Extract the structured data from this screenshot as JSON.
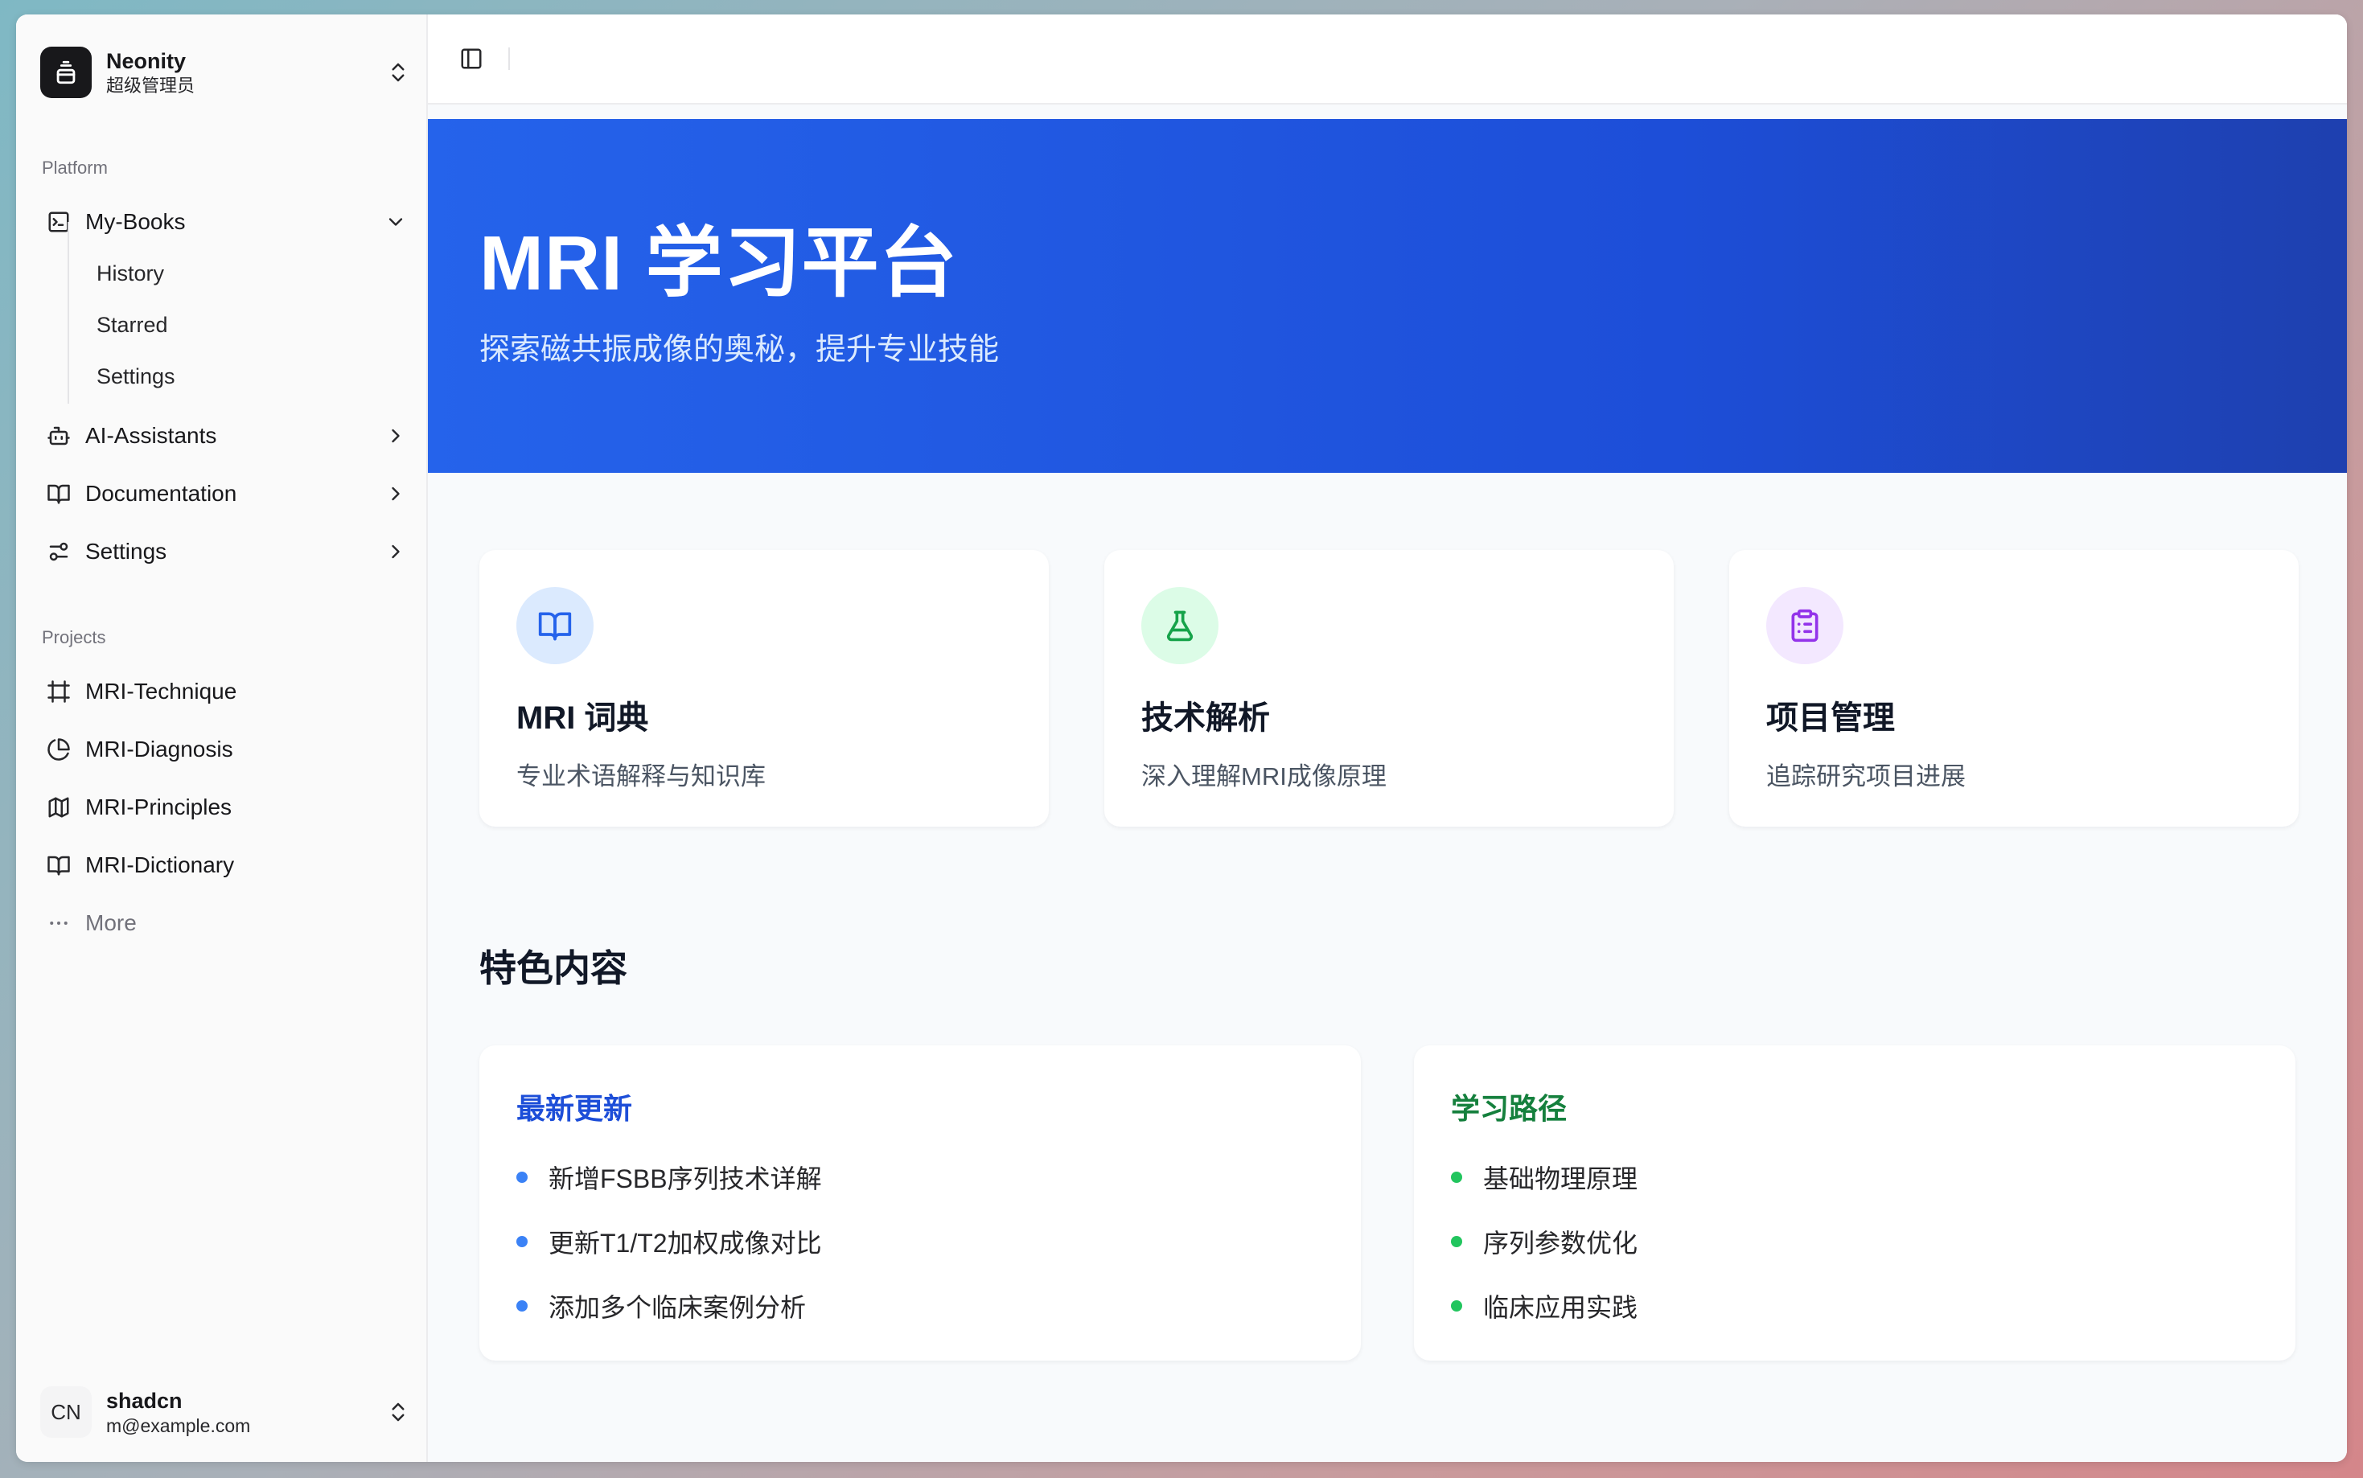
{
  "team": {
    "name": "Neonity",
    "role": "超级管理员"
  },
  "platform": {
    "label": "Platform",
    "items": [
      {
        "label": "My-Books",
        "icon": "terminal-icon",
        "expanded": true,
        "children": [
          {
            "label": "History"
          },
          {
            "label": "Starred"
          },
          {
            "label": "Settings"
          }
        ]
      },
      {
        "label": "AI-Assistants",
        "icon": "bot-icon"
      },
      {
        "label": "Documentation",
        "icon": "book-open-icon"
      },
      {
        "label": "Settings",
        "icon": "settings-sliders-icon"
      }
    ]
  },
  "projects": {
    "label": "Projects",
    "items": [
      {
        "label": "MRI-Technique",
        "icon": "hash-frame-icon"
      },
      {
        "label": "MRI-Diagnosis",
        "icon": "pie-chart-icon"
      },
      {
        "label": "MRI-Principles",
        "icon": "map-icon"
      },
      {
        "label": "MRI-Dictionary",
        "icon": "book-open-icon"
      },
      {
        "label": "More",
        "icon": "more-dots-icon"
      }
    ]
  },
  "user": {
    "name": "shadcn",
    "email": "m@example.com",
    "initials": "CN"
  },
  "hero": {
    "title": "MRI 学习平台",
    "subtitle": "探索磁共振成像的奥秘，提升专业技能"
  },
  "cards": [
    {
      "title": "MRI 词典",
      "desc": "专业术语解释与知识库",
      "icon": "book-open-icon",
      "color": "#2563eb",
      "bg": "#dbeafe"
    },
    {
      "title": "技术解析",
      "desc": "深入理解MRI成像原理",
      "icon": "flask-icon",
      "color": "#16a34a",
      "bg": "#dcfce7"
    },
    {
      "title": "项目管理",
      "desc": "追踪研究项目进展",
      "icon": "clipboard-list-icon",
      "color": "#9333ea",
      "bg": "#f3e8ff"
    }
  ],
  "featured": {
    "title": "特色内容",
    "panels": [
      {
        "title": "最新更新",
        "color": "#1d4ed8",
        "dot": "#3b82f6",
        "items": [
          "新增FSBB序列技术详解",
          "更新T1/T2加权成像对比",
          "添加多个临床案例分析"
        ]
      },
      {
        "title": "学习路径",
        "color": "#15803d",
        "dot": "#22c55e",
        "items": [
          "基础物理原理",
          "序列参数优化",
          "临床应用实践"
        ]
      }
    ]
  }
}
